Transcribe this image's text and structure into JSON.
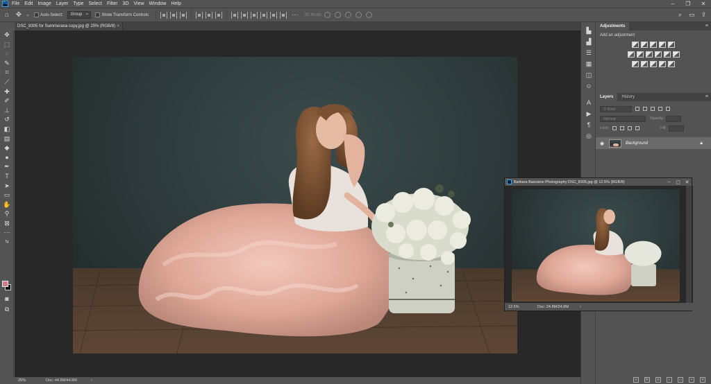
{
  "menubar": {
    "items": [
      "File",
      "Edit",
      "Image",
      "Layer",
      "Type",
      "Select",
      "Filter",
      "3D",
      "View",
      "Window",
      "Help"
    ],
    "logo": "Ps",
    "controls": [
      "–",
      "❐",
      "✕"
    ]
  },
  "options": {
    "auto_select_label": "Auto-Select:",
    "group_value": "Group",
    "transform_label": "Show Transform Controls",
    "mode_3d_label": "3D Mode:"
  },
  "document": {
    "tab_title": "DSC_8305 for Summerana copy.jpg @ 25% (RGB/8)",
    "zoom": "25%",
    "doc_size": "Doc: 44.8M/44.8M"
  },
  "adjustments": {
    "tab_label": "Adjustments",
    "subtitle": "Add an adjustment"
  },
  "layers": {
    "tabs": [
      "Layers",
      "History"
    ],
    "kind_label": "Kind",
    "blend_mode": "Normal",
    "opacity_label": "Opacity:",
    "lock_label": "Lock:",
    "fill_label": "Fill:",
    "layer_name": "Background"
  },
  "float_window": {
    "title": "Barbara Basciano Photography DSC_8305.jpg @ 12.5% (RGB/8)",
    "zoom": "12.5%",
    "doc_size": "Doc: 24.8M/24.8M"
  }
}
